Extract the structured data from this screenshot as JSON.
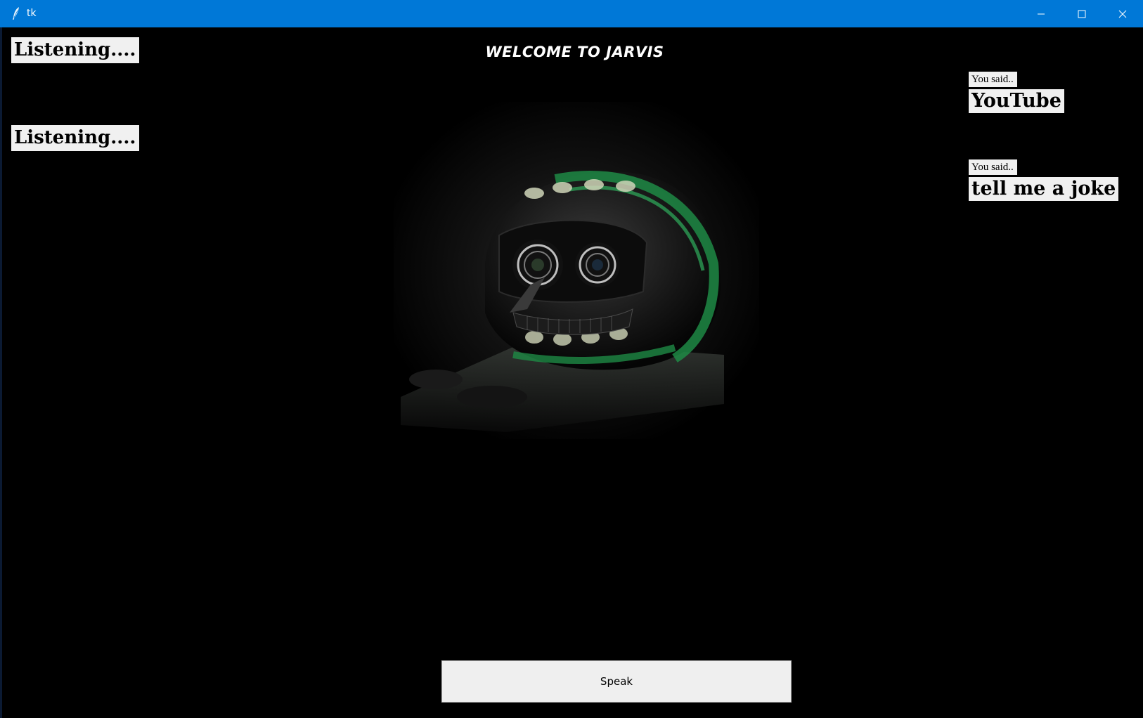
{
  "window": {
    "title": "tk",
    "colors": {
      "titlebar": "#0078d7",
      "background": "#000000",
      "label_bg": "#f0f0f0",
      "accent_green": "#1f8f4a"
    },
    "controls": {
      "minimize_icon": "minimize-icon",
      "maximize_icon": "maximize-icon",
      "close_icon": "close-icon"
    }
  },
  "header": {
    "welcome_text": "WELCOME TO JARVIS"
  },
  "status": {
    "listening_1": "Listening....",
    "listening_2": "Listening...."
  },
  "transcript": [
    {
      "prefix": "You said..",
      "text": "YouTube"
    },
    {
      "prefix": "You said..",
      "text": "tell me a joke"
    }
  ],
  "hero_image": {
    "icon": "robot-helmet-image"
  },
  "actions": {
    "speak_label": "Speak"
  }
}
